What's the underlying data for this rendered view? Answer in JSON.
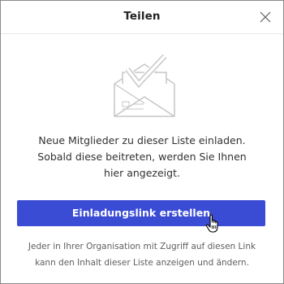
{
  "dialog": {
    "title": "Teilen",
    "close_icon": "close-icon"
  },
  "illustration": {
    "icon": "envelope-checkmark-icon"
  },
  "message": {
    "line1": "Neue Mitglieder zu dieser Liste einladen.",
    "line2": "Sobald diese beitreten, werden Sie Ihnen",
    "line3": "hier angezeigt."
  },
  "actions": {
    "create_link_label": "Einladungslink erstellen",
    "accent_color": "#3b4cd4"
  },
  "footnote": {
    "line1": "Jeder in Ihrer Organisation mit Zugriff auf diesen Link",
    "line2": "kann den Inhalt dieser Liste anzeigen und ändern."
  }
}
